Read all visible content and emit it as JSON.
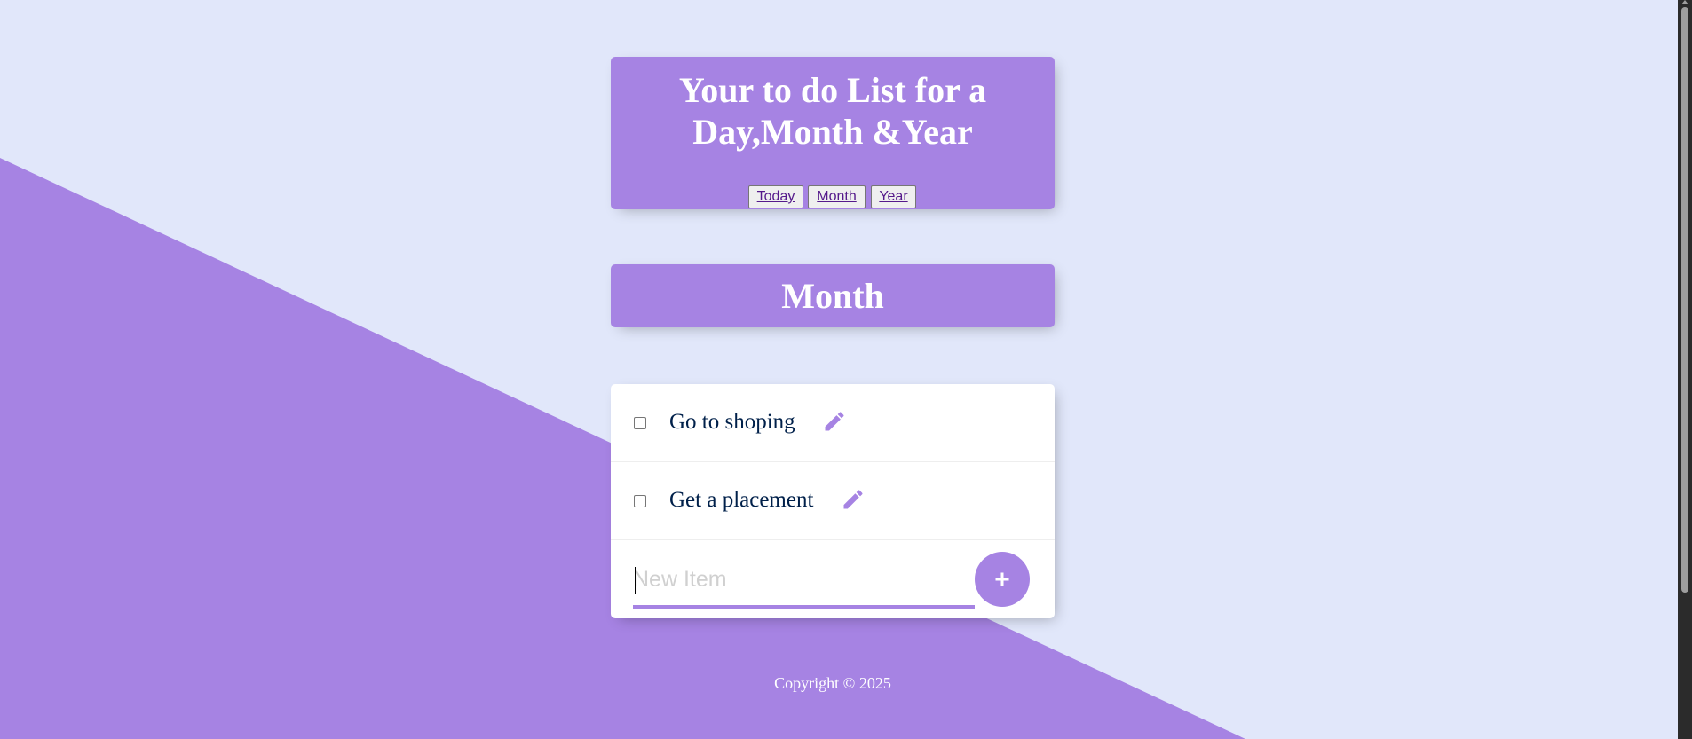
{
  "header": {
    "title_line1": "Your to do List for a",
    "title_line2": "Day,Month &Year",
    "tabs": [
      {
        "label": "Today"
      },
      {
        "label": "Month"
      },
      {
        "label": "Year"
      }
    ]
  },
  "list": {
    "title": "Month",
    "items": [
      {
        "text": "Go to shoping",
        "checked": false,
        "icon": "pencil-icon"
      },
      {
        "text": "Get a placement",
        "checked": false,
        "icon": "pencil-icon"
      }
    ],
    "new_item": {
      "placeholder": "New Item",
      "value": ""
    },
    "add_button": {
      "icon": "plus-icon"
    }
  },
  "footer": {
    "text": "Copyright © 2025"
  },
  "colors": {
    "background": "#E1E7FA",
    "accent": "#A683E3",
    "text": "#00204A",
    "white": "#FFFFFF"
  }
}
